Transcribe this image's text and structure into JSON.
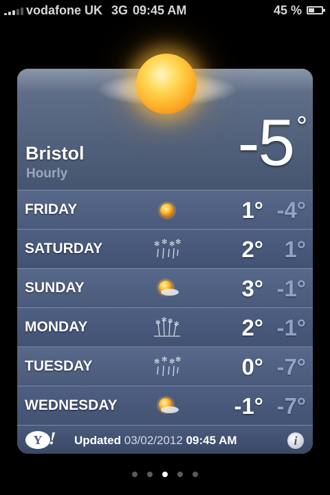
{
  "status_bar": {
    "carrier": "vodafone UK",
    "network": "3G",
    "time": "09:45 AM",
    "battery_percent": "45 %",
    "battery_level": 0.45
  },
  "weather": {
    "city": "Bristol",
    "subtitle": "Hourly",
    "current_temp": "-5",
    "degree_symbol": "°",
    "current_condition_icon": "sun-cloud-icon"
  },
  "forecast": [
    {
      "day": "FRIDAY",
      "icon": "sun-icon",
      "high": "1°",
      "low": "-4°"
    },
    {
      "day": "SATURDAY",
      "icon": "snow-rain-icon",
      "high": "2°",
      "low": "1°"
    },
    {
      "day": "SUNDAY",
      "icon": "partly-sunny-icon",
      "high": "3°",
      "low": "-1°"
    },
    {
      "day": "MONDAY",
      "icon": "frost-icon",
      "high": "2°",
      "low": "-1°"
    },
    {
      "day": "TUESDAY",
      "icon": "snow-rain-icon",
      "high": "0°",
      "low": "-7°"
    },
    {
      "day": "WEDNESDAY",
      "icon": "partly-sunny-icon",
      "high": "-1°",
      "low": "-7°"
    }
  ],
  "footer": {
    "logo_text": "Y!",
    "updated_label": "Updated",
    "updated_date": "03/02/2012",
    "updated_time": "09:45 AM",
    "info_label": "i"
  },
  "page_indicator": {
    "count": 5,
    "active_index": 2
  }
}
